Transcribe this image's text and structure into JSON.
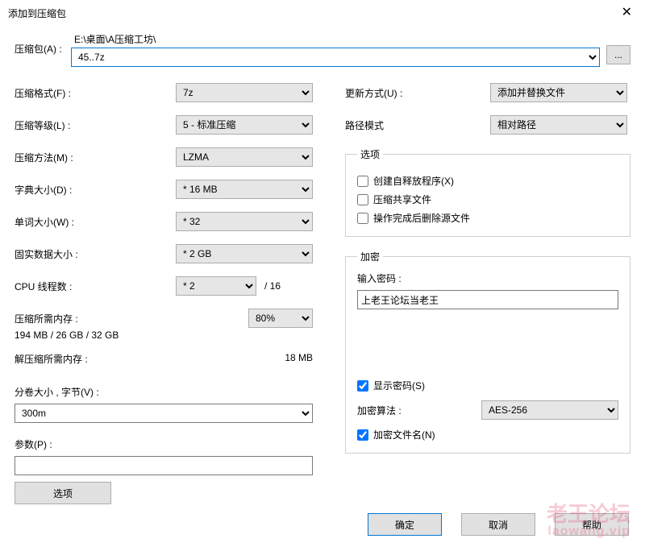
{
  "title": "添加到压缩包",
  "archive": {
    "label": "压缩包(A) :",
    "path": "E:\\桌面\\A压缩工坊\\",
    "filename": "45..7z",
    "browse": "..."
  },
  "left": {
    "format_label": "压缩格式(F) :",
    "format_value": "7z",
    "level_label": "压缩等级(L) :",
    "level_value": "5 - 标准压缩",
    "method_label": "压缩方法(M) :",
    "method_value": "LZMA",
    "dict_label": "字典大小(D) :",
    "dict_value": "* 16 MB",
    "word_label": "单词大小(W) :",
    "word_value": "* 32",
    "solid_label": "固实数据大小 :",
    "solid_value": "* 2 GB",
    "cpu_label": "CPU 线程数 :",
    "cpu_value": "* 2",
    "cpu_total": "/ 16",
    "mem_label": "压缩所需内存 :",
    "mem_pct": "80%",
    "mem_val": "194 MB / 26 GB / 32 GB",
    "decomp_label": "解压缩所需内存 :",
    "decomp_val": "18 MB",
    "vol_label": "分卷大小 , 字节(V) :",
    "vol_value": "300m",
    "param_label": "参数(P) :",
    "param_value": "",
    "options_btn": "选项"
  },
  "right": {
    "update_label": "更新方式(U) :",
    "update_value": "添加并替换文件",
    "pathmode_label": "路径模式",
    "pathmode_value": "相对路径",
    "opts_legend": "选项",
    "opt_sfx": "创建自释放程序(X)",
    "opt_shared": "压缩共享文件",
    "opt_delete": "操作完成后删除源文件",
    "enc_legend": "加密",
    "enc_pass_label": "输入密码 :",
    "enc_pass_value": "上老王论坛当老王",
    "enc_show": "显示密码(S)",
    "enc_alg_label": "加密算法 :",
    "enc_alg_value": "AES-256",
    "enc_names": "加密文件名(N)"
  },
  "buttons": {
    "ok": "确定",
    "cancel": "取消",
    "help": "帮助"
  },
  "watermark": {
    "main": "老王论坛",
    "sub": "laowang.vip"
  }
}
